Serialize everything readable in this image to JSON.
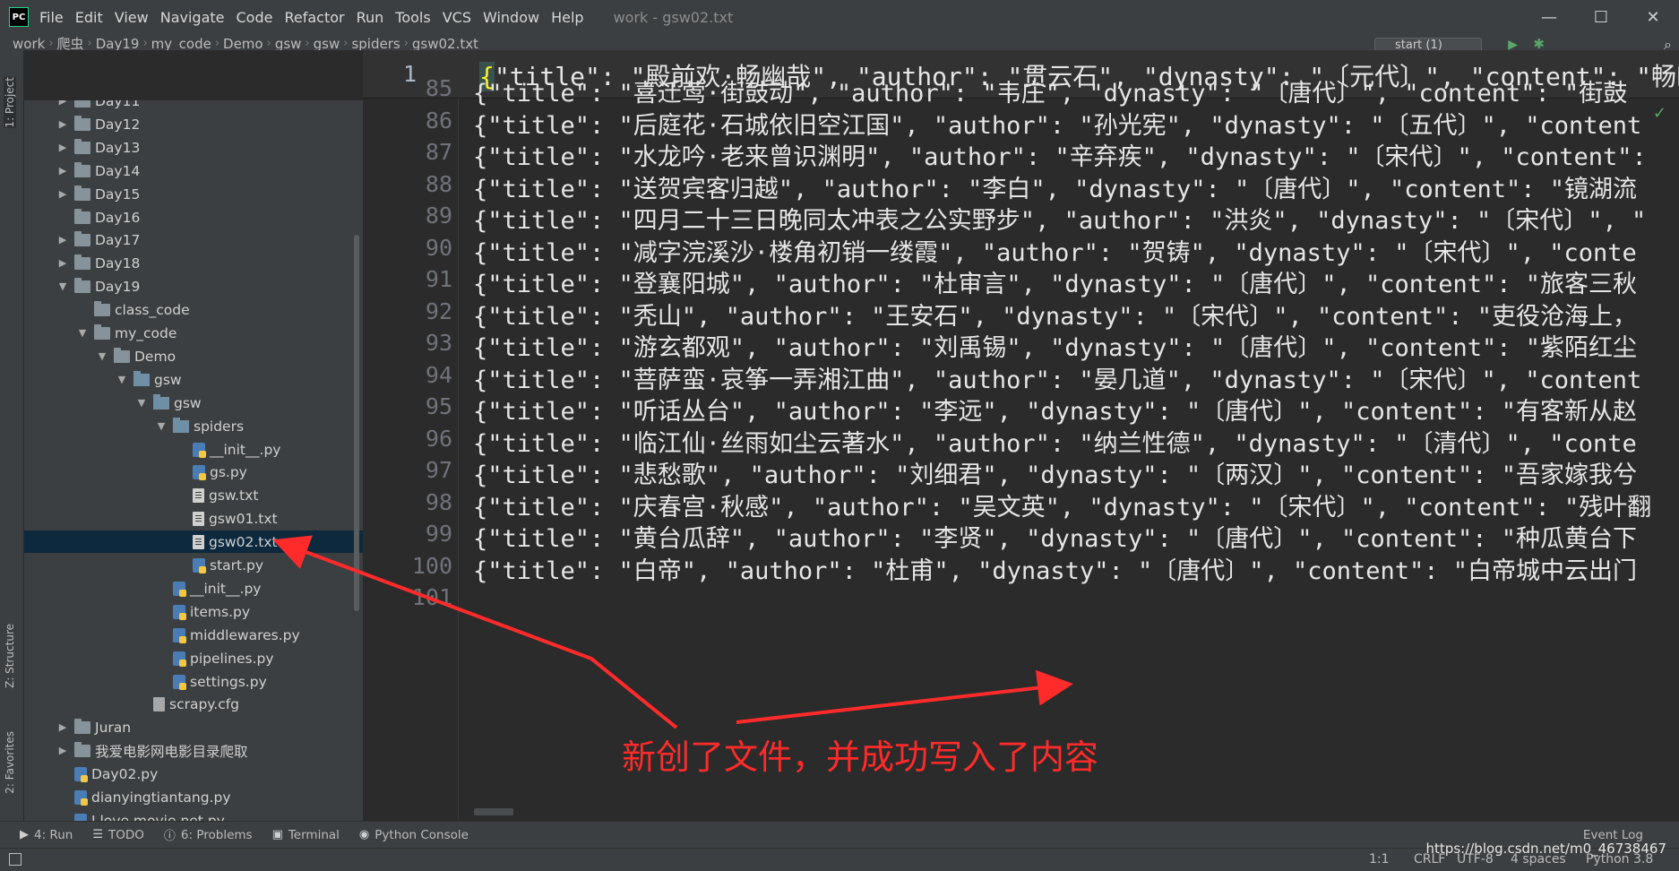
{
  "menubar": {
    "logo": "PC",
    "items": [
      "File",
      "Edit",
      "View",
      "Navigate",
      "Code",
      "Refactor",
      "Run",
      "Tools",
      "VCS",
      "Window",
      "Help"
    ],
    "window_title": "work - gsw02.txt",
    "controls": [
      "—",
      "☐",
      "✕"
    ]
  },
  "navbar": {
    "crumbs": [
      "work",
      "爬虫",
      "Day19",
      "my_code",
      "Demo",
      "gsw",
      "gsw",
      "spiders",
      "gsw02.txt"
    ],
    "run_config": "start (1)"
  },
  "left_strip": {
    "project_tab": "1: Project",
    "structure_tab": "Z: Structure",
    "favorites_tab": "2: Favorites"
  },
  "project_tree": [
    {
      "label": "Day11",
      "icon": "folder",
      "caret": "right",
      "level": 0
    },
    {
      "label": "Day12",
      "icon": "folder",
      "caret": "right",
      "level": 0
    },
    {
      "label": "Day13",
      "icon": "folder",
      "caret": "right",
      "level": 0
    },
    {
      "label": "Day14",
      "icon": "folder",
      "caret": "right",
      "level": 0
    },
    {
      "label": "Day15",
      "icon": "folder",
      "caret": "right",
      "level": 0
    },
    {
      "label": "Day16",
      "icon": "folder",
      "caret": "none",
      "level": 0
    },
    {
      "label": "Day17",
      "icon": "folder",
      "caret": "right",
      "level": 0
    },
    {
      "label": "Day18",
      "icon": "folder",
      "caret": "right",
      "level": 0
    },
    {
      "label": "Day19",
      "icon": "folder",
      "caret": "down",
      "level": 0
    },
    {
      "label": "class_code",
      "icon": "folder",
      "caret": "none",
      "level": 1
    },
    {
      "label": "my_code",
      "icon": "folder",
      "caret": "down",
      "level": 1
    },
    {
      "label": "Demo",
      "icon": "folder",
      "caret": "down",
      "level": 2
    },
    {
      "label": "gsw",
      "icon": "folder-blue",
      "caret": "down",
      "level": 3
    },
    {
      "label": "gsw",
      "icon": "pkg",
      "caret": "down",
      "level": 4
    },
    {
      "label": "spiders",
      "icon": "pkg",
      "caret": "down",
      "level": 5
    },
    {
      "label": "__init__.py",
      "icon": "py",
      "caret": "none",
      "level": 6
    },
    {
      "label": "gs.py",
      "icon": "py",
      "caret": "none",
      "level": 6
    },
    {
      "label": "gsw.txt",
      "icon": "txt",
      "caret": "none",
      "level": 6
    },
    {
      "label": "gsw01.txt",
      "icon": "txt",
      "caret": "none",
      "level": 6
    },
    {
      "label": "gsw02.txt",
      "icon": "txt",
      "caret": "none",
      "level": 6,
      "selected": true
    },
    {
      "label": "start.py",
      "icon": "py",
      "caret": "none",
      "level": 6
    },
    {
      "label": "__init__.py",
      "icon": "py",
      "caret": "none",
      "level": 5
    },
    {
      "label": "items.py",
      "icon": "py",
      "caret": "none",
      "level": 5
    },
    {
      "label": "middlewares.py",
      "icon": "py",
      "caret": "none",
      "level": 5
    },
    {
      "label": "pipelines.py",
      "icon": "py",
      "caret": "none",
      "level": 5
    },
    {
      "label": "settings.py",
      "icon": "py",
      "caret": "none",
      "level": 5
    },
    {
      "label": "scrapy.cfg",
      "icon": "cfg",
      "caret": "none",
      "level": 4
    },
    {
      "label": "Juran",
      "icon": "folder",
      "caret": "right",
      "level": 0
    },
    {
      "label": "我爱电影网电影目录爬取",
      "icon": "folder",
      "caret": "right",
      "level": 0
    },
    {
      "label": "Day02.py",
      "icon": "py",
      "caret": "none",
      "level": 0
    },
    {
      "label": "dianyingtiantang.py",
      "icon": "py",
      "caret": "none",
      "level": 0
    },
    {
      "label": "I love movie net.py",
      "icon": "py",
      "caret": "none",
      "level": 0
    },
    {
      "label": "test.py",
      "icon": "py",
      "caret": "none",
      "level": 0
    }
  ],
  "editor": {
    "sticky_line_number": "1",
    "sticky_open_brace": "{",
    "sticky_code": "\"title\": \"殿前欢·畅幽哉\", \"author\": \"贯云石\", \"dynasty\": \"〔元代〕\", \"content\": \"畅幽哉，春风无处不楼台。一时怀抱",
    "lines": [
      {
        "n": "85",
        "text": "{\"title\": \"喜迁莺·街鼓动\", \"author\": \"韦庄\", \"dynasty\": \"〔唐代〕\", \"content\": \"街鼓"
      },
      {
        "n": "86",
        "text": "{\"title\": \"后庭花·石城依旧空江国\", \"author\": \"孙光宪\", \"dynasty\": \"〔五代〕\", \"content"
      },
      {
        "n": "87",
        "text": "{\"title\": \"水龙吟·老来曾识渊明\", \"author\": \"辛弃疾\", \"dynasty\": \"〔宋代〕\", \"content\":"
      },
      {
        "n": "88",
        "text": "{\"title\": \"送贺宾客归越\", \"author\": \"李白\", \"dynasty\": \"〔唐代〕\", \"content\": \"镜湖流"
      },
      {
        "n": "89",
        "text": "{\"title\": \"四月二十三日晚同太冲表之公实野步\", \"author\": \"洪炎\", \"dynasty\": \"〔宋代〕\", \""
      },
      {
        "n": "90",
        "text": "{\"title\": \"减字浣溪沙·楼角初销一缕霞\", \"author\": \"贺铸\", \"dynasty\": \"〔宋代〕\", \"conte"
      },
      {
        "n": "91",
        "text": "{\"title\": \"登襄阳城\", \"author\": \"杜审言\", \"dynasty\": \"〔唐代〕\", \"content\": \"旅客三秋"
      },
      {
        "n": "92",
        "text": "{\"title\": \"秃山\", \"author\": \"王安石\", \"dynasty\": \"〔宋代〕\", \"content\": \"吏役沧海上，"
      },
      {
        "n": "93",
        "text": "{\"title\": \"游玄都观\", \"author\": \"刘禹锡\", \"dynasty\": \"〔唐代〕\", \"content\": \"紫陌红尘"
      },
      {
        "n": "94",
        "text": "{\"title\": \"菩萨蛮·哀筝一弄湘江曲\", \"author\": \"晏几道\", \"dynasty\": \"〔宋代〕\", \"content"
      },
      {
        "n": "95",
        "text": "{\"title\": \"听话丛台\", \"author\": \"李远\", \"dynasty\": \"〔唐代〕\", \"content\": \"有客新从赵"
      },
      {
        "n": "96",
        "text": "{\"title\": \"临江仙·丝雨如尘云著水\", \"author\": \"纳兰性德\", \"dynasty\": \"〔清代〕\", \"conte"
      },
      {
        "n": "97",
        "text": "{\"title\": \"悲愁歌\", \"author\": \"刘细君\", \"dynasty\": \"〔两汉〕\", \"content\": \"吾家嫁我兮"
      },
      {
        "n": "98",
        "text": "{\"title\": \"庆春宫·秋感\", \"author\": \"吴文英\", \"dynasty\": \"〔宋代〕\", \"content\": \"残叶翻"
      },
      {
        "n": "99",
        "text": "{\"title\": \"黄台瓜辞\", \"author\": \"李贤\", \"dynasty\": \"〔唐代〕\", \"content\": \"种瓜黄台下"
      },
      {
        "n": "100",
        "text": "{\"title\": \"白帝\", \"author\": \"杜甫\", \"dynasty\": \"〔唐代〕\", \"content\": \"白帝城中云出门"
      },
      {
        "n": "101",
        "text": ""
      }
    ]
  },
  "annotation": "新创了文件，并成功写入了内容",
  "bottom_tools": [
    {
      "icon": "▶",
      "label": "4: Run"
    },
    {
      "icon": "☰",
      "label": "TODO"
    },
    {
      "icon": "ⓘ",
      "label": "6: Problems"
    },
    {
      "icon": "▣",
      "label": "Terminal"
    },
    {
      "icon": "◉",
      "label": "Python Console"
    }
  ],
  "event_log": "Event Log",
  "status": {
    "position": "1:1",
    "line_sep": "CRLF",
    "encoding": "UTF-8",
    "indent": "4 spaces",
    "interpreter": "Python 3.8"
  },
  "watermark": "https://blog.csdn.net/m0_46738467",
  "colors": {
    "annotation_red": "#ff2b2b",
    "selection": "#0d293e",
    "editor_bg": "#2b2b2b",
    "panel_bg": "#3c3f41"
  }
}
